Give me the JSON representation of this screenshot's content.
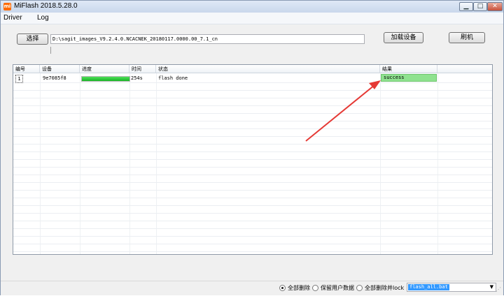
{
  "window": {
    "title": "MiFlash 2018.5.28.0",
    "icon": "mi-icon"
  },
  "window_controls": {
    "minimize": "▁",
    "maximize": "□",
    "close": "✕"
  },
  "menu": [
    {
      "label": "Driver"
    },
    {
      "label": "Log"
    }
  ],
  "toolbar": {
    "select_label": "选择",
    "path_value": "D:\\sagit_images_V9.2.4.0.NCACNEK_20180117.0000.00_7.1_cn",
    "load_devices_label": "加载设备",
    "flash_label": "刷机"
  },
  "table": {
    "columns": [
      "编号",
      "设备",
      "进度",
      "时间",
      "状态",
      "结果"
    ],
    "rows": [
      {
        "num": "1",
        "device": "9e7085f8",
        "progress": 1.0,
        "time": "254s",
        "status": "flash done",
        "result": "success"
      }
    ]
  },
  "footer": {
    "options": [
      {
        "label": "全部删除",
        "checked": true
      },
      {
        "label": "保留用户数据",
        "checked": false
      },
      {
        "label": "全部删除并lock",
        "checked": false
      }
    ],
    "script_value": "flash_all.bat",
    "dropdown_icon": "▼",
    "grip_icon": "⋰"
  },
  "colors": {
    "success": "#8fe28f",
    "progress": "#19b526",
    "arrow": "#e53935",
    "selection": "#3399ff"
  }
}
